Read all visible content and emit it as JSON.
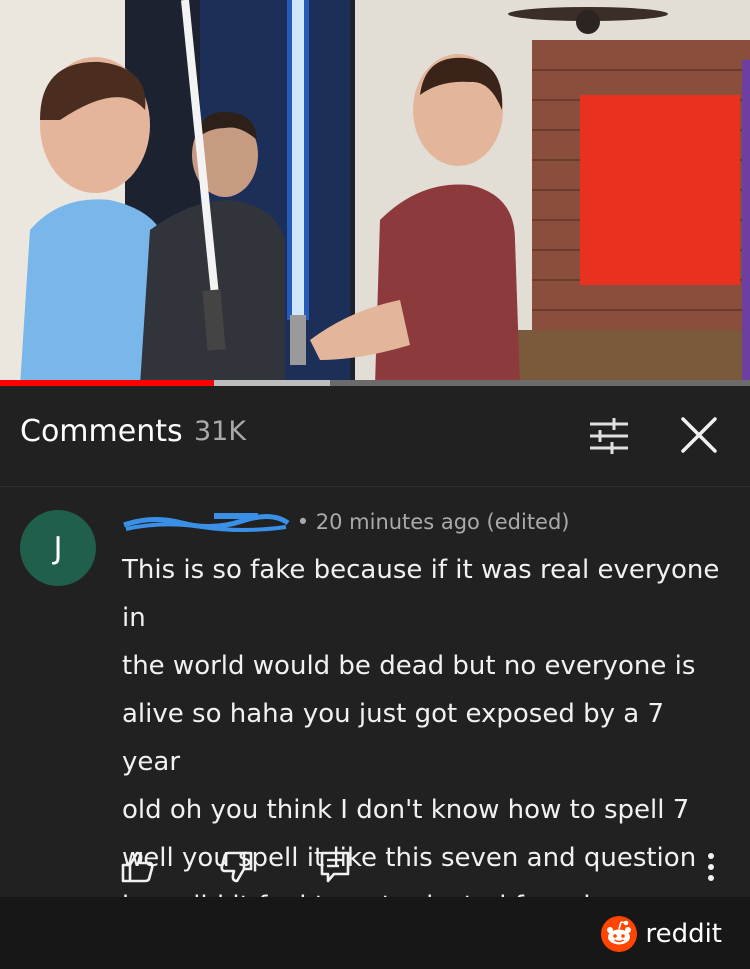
{
  "video": {
    "progress_played": 0.285,
    "progress_buffered": 0.44
  },
  "comments": {
    "title": "Comments",
    "count": "31K",
    "icons": {
      "filter": "sliders-icon",
      "close": "close-icon"
    }
  },
  "comment": {
    "avatar_letter": "J",
    "meta": "• 20 minutes ago (edited)",
    "text": "This is so fake because if it was real everyone in\nthe world would be dead but no everyone is\nalive so haha you just got exposed by a 7 year\nold oh you think I don't know how to spell 7\nwell you spell it like this seven and question\nhow did it feel to get rejected from heaven",
    "actions": [
      "thumbs-up-icon",
      "thumbs-down-icon",
      "reply-icon",
      "more-vertical-icon"
    ]
  },
  "watermark": {
    "brand": "reddit",
    "color": "#ff4500"
  }
}
